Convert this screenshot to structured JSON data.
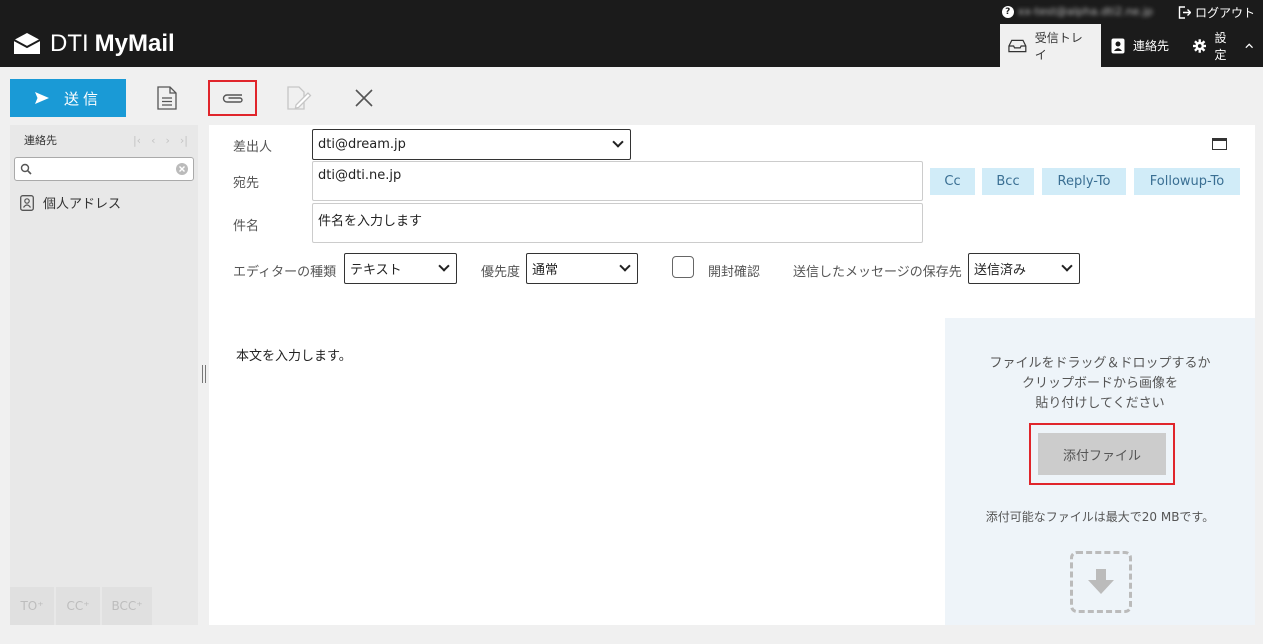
{
  "topbar": {
    "help_icon": "?",
    "user_email": "xx-test@alpha.dti2.ne.jp",
    "logout_label": "ログアウト"
  },
  "header": {
    "logo_prefix": "DTI",
    "logo_suffix": "MyMail",
    "tabs": [
      {
        "label": "受信トレイ",
        "icon": "inbox-icon",
        "active": true
      },
      {
        "label": "連絡先",
        "icon": "contact-icon",
        "active": false
      },
      {
        "label": "設定",
        "icon": "gear-icon",
        "active": false
      }
    ]
  },
  "toolbar": {
    "send_label": "送信",
    "icons": [
      "template-icon",
      "paperclip-icon",
      "signature-icon",
      "close-icon"
    ]
  },
  "sidebar": {
    "title": "連絡先",
    "search_placeholder": "",
    "items": [
      {
        "label": "個人アドレス"
      }
    ],
    "bottom_buttons": [
      "TO⁺",
      "CC⁺",
      "BCC⁺"
    ]
  },
  "form": {
    "from_label": "差出人",
    "from_value": "dti@dream.jp",
    "to_label": "宛先",
    "to_value": "dti@dti.ne.jp",
    "subject_label": "件名",
    "subject_value": "件名を入力します",
    "chips": [
      "Cc",
      "Bcc",
      "Reply-To",
      "Followup-To"
    ],
    "editor_label": "エディターの種類",
    "editor_value": "テキスト",
    "priority_label": "優先度",
    "priority_value": "通常",
    "receipt_label": "開封確認",
    "save_label": "送信したメッセージの保存先",
    "save_value": "送信済み"
  },
  "body": {
    "text": "本文を入力します。"
  },
  "attach": {
    "hint_line1": "ファイルをドラッグ＆ドロップするか",
    "hint_line2": "クリップボードから画像を",
    "hint_line3": "貼り付けしてください",
    "button_label": "添付ファイル",
    "limit_text": "添付可能なファイルは最大で20 MBです。"
  },
  "colors": {
    "accent": "#1a9ad6",
    "highlight": "#e0252b",
    "header_bg": "#1b1b1b",
    "chip_bg": "#d1ecf8"
  }
}
